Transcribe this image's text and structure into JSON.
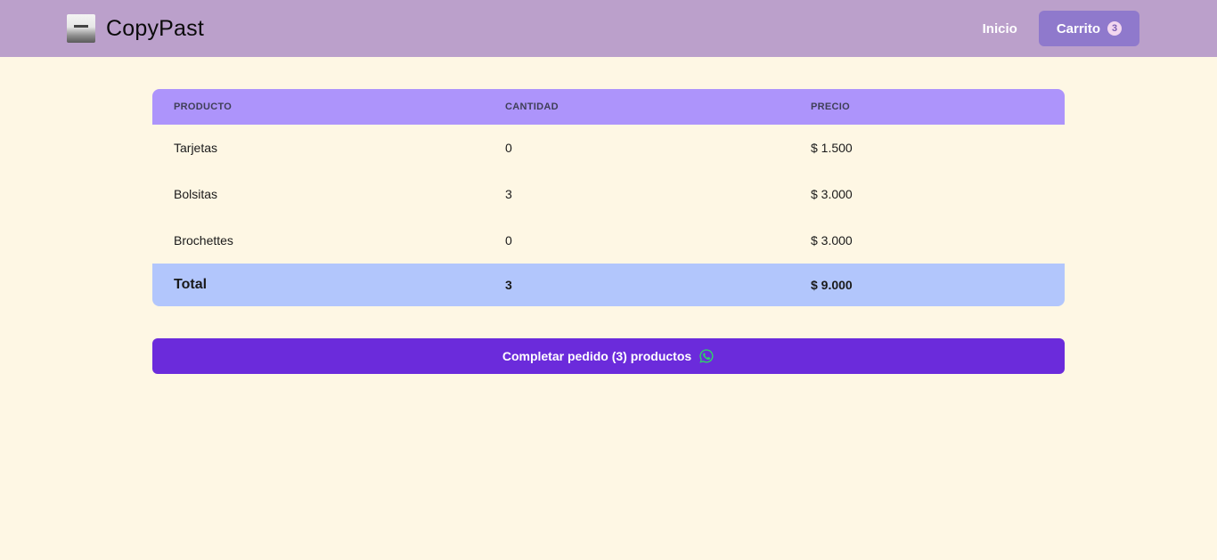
{
  "header": {
    "brand": "CopyPast",
    "nav_inicio": "Inicio",
    "cart_label": "Carrito",
    "cart_count": "3"
  },
  "table": {
    "columns": [
      "PRODUCTO",
      "CANTIDAD",
      "PRECIO"
    ],
    "rows": [
      {
        "producto": "Tarjetas",
        "cantidad": "0",
        "precio": "$ 1.500"
      },
      {
        "producto": "Bolsitas",
        "cantidad": "3",
        "precio": "$ 3.000"
      },
      {
        "producto": "Brochettes",
        "cantidad": "0",
        "precio": "$ 3.000"
      }
    ],
    "total": {
      "label": "Total",
      "cantidad": "3",
      "precio": "$ 9.000"
    }
  },
  "submit": {
    "label": "Completar pedido (3) productos",
    "icon": "whatsapp-icon"
  },
  "colors": {
    "navbar": "#bba0cb",
    "cart_button": "#8f79cc",
    "table_header": "#ad94fb",
    "total_row": "#b2c6fc",
    "submit_button": "#6b2bdb",
    "background": "#fef7e4",
    "whatsapp": "#2fd565"
  }
}
